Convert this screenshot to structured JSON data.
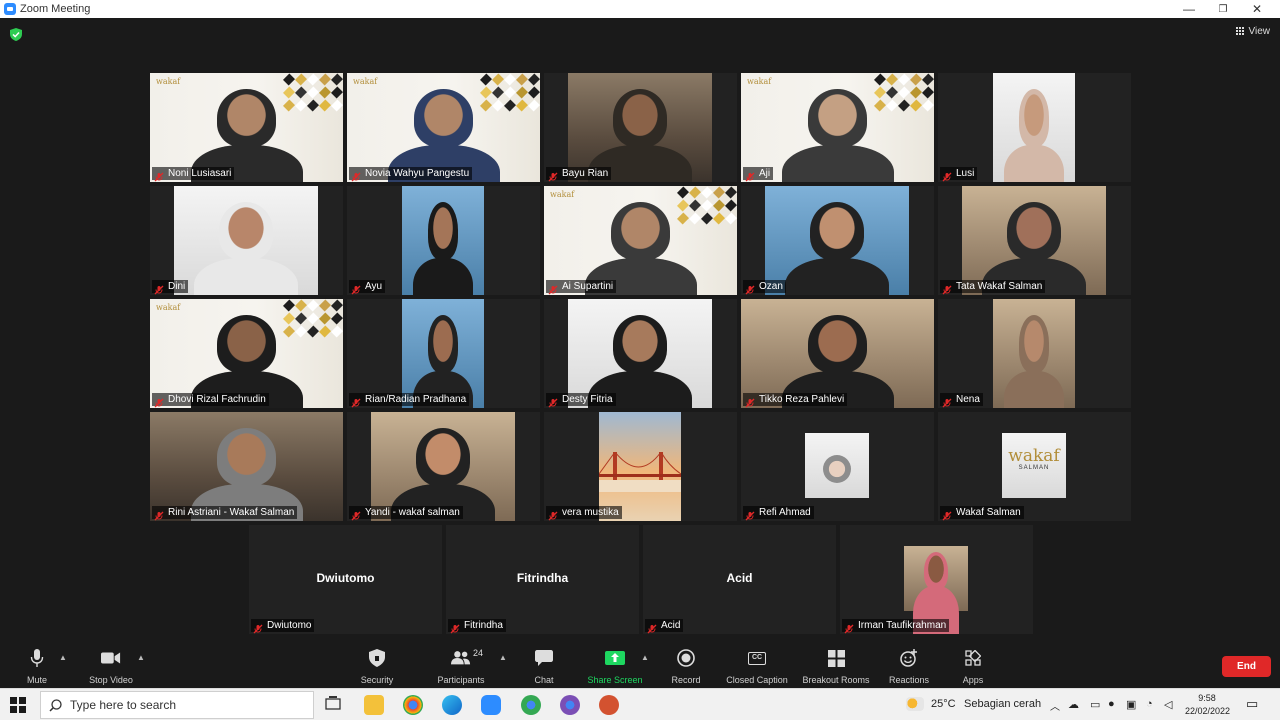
{
  "window": {
    "title": "Zoom Meeting",
    "minimize": "—",
    "maximize": "❐",
    "close": "✕"
  },
  "header": {
    "view_label": "View"
  },
  "tiles": [
    {
      "name": "Noni Lusiasari"
    },
    {
      "name": "Novia Wahyu Pangestu"
    },
    {
      "name": "Bayu Rian"
    },
    {
      "name": "Aji"
    },
    {
      "name": "Lusi"
    },
    {
      "name": "Dini"
    },
    {
      "name": "Ayu"
    },
    {
      "name": "Ai Supartini"
    },
    {
      "name": "Ozan"
    },
    {
      "name": "Tata Wakaf Salman"
    },
    {
      "name": "Dhovi Rizal Fachrudin"
    },
    {
      "name": "Rian/Radian Pradhana"
    },
    {
      "name": "Desty Fitria"
    },
    {
      "name": "Tikko Reza Pahlevi"
    },
    {
      "name": "Nena"
    },
    {
      "name": "Rini Astriani - Wakaf Salman"
    },
    {
      "name": "Yandi - wakaf salman"
    },
    {
      "name": "vera mustika"
    },
    {
      "name": "Refi Ahmad"
    },
    {
      "name": "Wakaf Salman"
    },
    {
      "name": "Dwiutomo",
      "center": "Dwiutomo"
    },
    {
      "name": "Fitrindha",
      "center": "Fitrindha"
    },
    {
      "name": "Acid",
      "center": "Acid"
    },
    {
      "name": "Irman Taufikrahman"
    }
  ],
  "wakaf_logo": {
    "main": "wakaf",
    "sub": "SALMAN",
    "small": "wakaf"
  },
  "toolbar": {
    "mute": "Mute",
    "stop_video": "Stop Video",
    "security": "Security",
    "participants": "Participants",
    "participants_count": "24",
    "chat": "Chat",
    "share_screen": "Share Screen",
    "record": "Record",
    "closed_caption": "Closed Caption",
    "closed_caption_icon_text": "CC",
    "breakout_rooms": "Breakout Rooms",
    "reactions": "Reactions",
    "apps": "Apps",
    "end": "End"
  },
  "taskbar": {
    "search_placeholder": "Type here to search",
    "temperature": "25°C",
    "weather": "Sebagian cerah",
    "time": "9:58",
    "date": "22/02/2022"
  },
  "colors": {
    "speaker_border": "#c2d63a",
    "share_green": "#1ed760",
    "end_red": "#e02828",
    "mic_off_red": "#e02828"
  }
}
